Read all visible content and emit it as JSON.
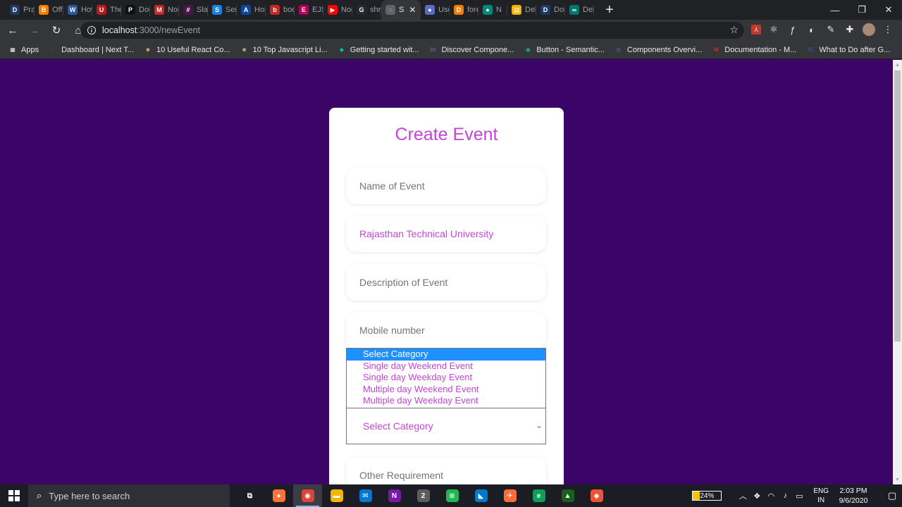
{
  "browser": {
    "tabs": [
      {
        "title": "Prad",
        "icon": "D",
        "color": "#1f3a64"
      },
      {
        "title": "Offic",
        "icon": "B",
        "color": "#f57c00"
      },
      {
        "title": "How",
        "icon": "W",
        "color": "#2b579a"
      },
      {
        "title": "The (",
        "icon": "U",
        "color": "#b71c1c"
      },
      {
        "title": "Docu",
        "icon": "P",
        "color": "#111111"
      },
      {
        "title": "Nod",
        "icon": "M",
        "color": "#c62828"
      },
      {
        "title": "Slack",
        "icon": "#",
        "color": "#4a154b"
      },
      {
        "title": "Send",
        "icon": "S",
        "color": "#1a82e2"
      },
      {
        "title": "Hom",
        "icon": "A",
        "color": "#0d47a1"
      },
      {
        "title": "body",
        "icon": "b",
        "color": "#c62828"
      },
      {
        "title": "EJS -",
        "icon": "E",
        "color": "#b4005a"
      },
      {
        "title": "Nod",
        "icon": "▶",
        "color": "#ff0000"
      },
      {
        "title": "shru",
        "icon": "G",
        "color": "#24292e"
      },
      {
        "title": "S",
        "icon": "◌",
        "color": "#5f6368",
        "active": true
      },
      {
        "title": "Use",
        "icon": "●",
        "color": "#5c6bc0"
      },
      {
        "title": "fore",
        "icon": "D",
        "color": "#f57c00"
      },
      {
        "title": "N",
        "icon": "●",
        "color": "#00897b"
      },
      {
        "title": "Delh",
        "icon": "▤",
        "color": "#f4b400"
      },
      {
        "title": "Don",
        "icon": "D",
        "color": "#1f3a64"
      },
      {
        "title": "Delh",
        "icon": "∞",
        "color": "#00796b"
      }
    ],
    "new_tab": "+",
    "window_controls": {
      "minimize": "—",
      "maximize": "❐",
      "close": "✕"
    },
    "nav": {
      "back": "←",
      "forward": "→",
      "reload": "↻",
      "home": "⌂"
    },
    "url": {
      "host": "localhost",
      "path": ":3000/newEvent"
    },
    "star": "☆",
    "extensions": [
      "pdf-icon",
      "react-icon",
      "function-icon",
      "circle-icon",
      "pen-icon",
      "puzzle-icon",
      "avatar",
      "menu-icon"
    ],
    "bookmarks": [
      {
        "label": "Apps",
        "icon": "▦",
        "color": "#e8eaed"
      },
      {
        "label": "Dashboard | Next T...",
        "icon": "n",
        "color": "#444444"
      },
      {
        "label": "10 Useful React Co...",
        "icon": "☻",
        "color": "#d2a679"
      },
      {
        "label": "10 Top Javascript Li...",
        "icon": "☻",
        "color": "#d2a679"
      },
      {
        "label": "Getting started wit...",
        "icon": "◆",
        "color": "#00c2a8"
      },
      {
        "label": "Discover Compone...",
        "icon": "bit",
        "color": "#6c5ce7"
      },
      {
        "label": "Button - Semantic...",
        "icon": "◉",
        "color": "#26a69a"
      },
      {
        "label": "Components Overvi...",
        "icon": "◇",
        "color": "#42a5f5"
      },
      {
        "label": "Documentation - M...",
        "icon": "M",
        "color": "#e53935"
      },
      {
        "label": "What to Do after G...",
        "icon": "IE",
        "color": "#1565c0"
      }
    ]
  },
  "form": {
    "title": "Create Event",
    "fields": {
      "name_placeholder": "Name of Event",
      "college_value": "Rajasthan Technical University",
      "description_placeholder": "Description of Event",
      "mobile_placeholder": "Mobile number",
      "category_value": "Select Category",
      "other_placeholder": "Other Requirement"
    },
    "category_options": [
      "Select Category",
      "Single day Weekend Event",
      "Single day Weekday Event",
      "Multiple day Weekend Event",
      "Multiple day Weekday Event"
    ]
  },
  "taskbar": {
    "search_placeholder": "Type here to search",
    "apps": [
      {
        "name": "task-view",
        "icon": "⧉",
        "color": "#1c1c24"
      },
      {
        "name": "firefox",
        "icon": "●",
        "color": "#ff7139"
      },
      {
        "name": "chrome",
        "icon": "◉",
        "color": "#db4437",
        "active": true
      },
      {
        "name": "file-explorer",
        "icon": "▬",
        "color": "#f4b400"
      },
      {
        "name": "mail",
        "icon": "✉",
        "color": "#0078d4"
      },
      {
        "name": "onenote",
        "icon": "N",
        "color": "#7719aa"
      },
      {
        "name": "app-badge",
        "icon": "2",
        "color": "#5c5c5c"
      },
      {
        "name": "spotify",
        "icon": "≋",
        "color": "#1db954"
      },
      {
        "name": "vscode",
        "icon": "◣",
        "color": "#007acc"
      },
      {
        "name": "postman",
        "icon": "✈",
        "color": "#ff6c37"
      },
      {
        "name": "edge",
        "icon": "e",
        "color": "#0f9d58"
      },
      {
        "name": "android",
        "icon": "▲",
        "color": "#1b5e20"
      },
      {
        "name": "git",
        "icon": "◆",
        "color": "#f05033"
      }
    ],
    "battery": "24%",
    "battery_level": 0.24,
    "language": {
      "line1": "ENG",
      "line2": "IN"
    },
    "time": "2:03 PM",
    "date": "9/6/2020"
  }
}
